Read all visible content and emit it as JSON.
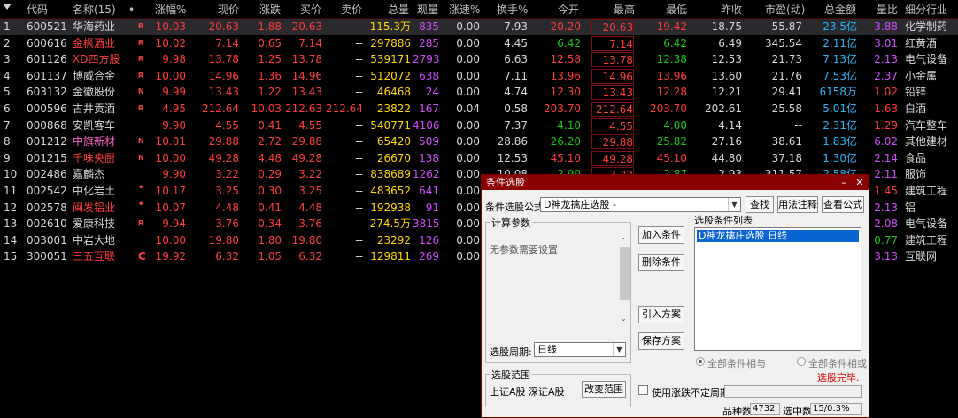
{
  "columns": [
    "代码",
    "名称(15)",
    "•",
    "涨幅%",
    "现价",
    "涨跌",
    "买价",
    "卖价",
    "总量",
    "现量",
    "涨速%",
    "换手%",
    "今开",
    "最高",
    "最低",
    "昨收",
    "市盈(动)",
    "总金额",
    "量比",
    "细分行业"
  ],
  "rows": [
    {
      "n": "1",
      "code": "600521",
      "name": "华海药业",
      "tag": "R",
      "pct": "10.03",
      "price": "20.63",
      "chg": "1.88",
      "bid": "20.63",
      "ask": "--",
      "vol": "115.3万",
      "cur": "835",
      "spd": "0.00",
      "turn": "7.93",
      "open": "20.20",
      "high": "20.63",
      "low": "19.42",
      "prev": "18.75",
      "pe": "55.87",
      "amt": "23.5亿",
      "vr": "3.88",
      "ind": "化学制药"
    },
    {
      "n": "2",
      "code": "600616",
      "name": "金枫酒业",
      "tag": "R",
      "pct": "10.02",
      "price": "7.14",
      "chg": "0.65",
      "bid": "7.14",
      "ask": "--",
      "vol": "297886",
      "cur": "285",
      "spd": "0.00",
      "turn": "4.45",
      "open": "6.42",
      "high": "7.14",
      "low": "6.42",
      "prev": "6.49",
      "pe": "345.54",
      "amt": "2.11亿",
      "vr": "3.01",
      "ind": "红黄酒"
    },
    {
      "n": "3",
      "code": "601126",
      "name": "XD四方股",
      "tag": "R",
      "pct": "9.98",
      "price": "13.78",
      "chg": "1.25",
      "bid": "13.78",
      "ask": "--",
      "vol": "539171",
      "cur": "2793",
      "spd": "0.00",
      "turn": "6.63",
      "open": "12.58",
      "high": "13.78",
      "low": "12.38",
      "prev": "12.53",
      "pe": "21.73",
      "amt": "7.13亿",
      "vr": "2.13",
      "ind": "电气设备"
    },
    {
      "n": "4",
      "code": "601137",
      "name": "博威合金",
      "tag": "R",
      "pct": "10.00",
      "price": "14.96",
      "chg": "1.36",
      "bid": "14.96",
      "ask": "--",
      "vol": "512072",
      "cur": "638",
      "spd": "0.00",
      "turn": "7.11",
      "open": "13.96",
      "high": "14.96",
      "low": "13.96",
      "prev": "13.60",
      "pe": "21.76",
      "amt": "7.53亿",
      "vr": "2.37",
      "ind": "小金属"
    },
    {
      "n": "5",
      "code": "603132",
      "name": "金徽股份",
      "tag": "N",
      "pct": "9.99",
      "price": "13.43",
      "chg": "1.22",
      "bid": "13.43",
      "ask": "--",
      "vol": "46468",
      "cur": "24",
      "spd": "0.00",
      "turn": "4.74",
      "open": "12.30",
      "high": "13.43",
      "low": "12.28",
      "prev": "12.21",
      "pe": "29.41",
      "amt": "6158万",
      "vr": "1.02",
      "ind": "铅锌"
    },
    {
      "n": "6",
      "code": "000596",
      "name": "古井贡酒",
      "tag": "R",
      "pct": "4.95",
      "price": "212.64",
      "chg": "10.03",
      "bid": "212.63",
      "ask": "212.64",
      "vol": "23822",
      "cur": "167",
      "spd": "0.04",
      "turn": "0.58",
      "open": "203.70",
      "high": "212.64",
      "low": "203.70",
      "prev": "202.61",
      "pe": "25.58",
      "amt": "5.01亿",
      "vr": "1.63",
      "ind": "白酒"
    },
    {
      "n": "7",
      "code": "000868",
      "name": "安凯客车",
      "tag": "",
      "pct": "9.90",
      "price": "4.55",
      "chg": "0.41",
      "bid": "4.55",
      "ask": "--",
      "vol": "540771",
      "cur": "4106",
      "spd": "0.00",
      "turn": "7.37",
      "open": "4.10",
      "high": "4.55",
      "low": "4.00",
      "prev": "4.14",
      "pe": "--",
      "amt": "2.31亿",
      "vr": "1.29",
      "ind": "汽车整车"
    },
    {
      "n": "8",
      "code": "001212",
      "name": "中旗新材",
      "tag": "N",
      "pct": "10.01",
      "price": "29.88",
      "chg": "2.72",
      "bid": "29.88",
      "ask": "--",
      "vol": "65420",
      "cur": "509",
      "spd": "0.00",
      "turn": "28.86",
      "open": "26.20",
      "high": "29.88",
      "low": "25.82",
      "prev": "27.16",
      "pe": "38.61",
      "amt": "1.83亿",
      "vr": "6.02",
      "ind": "其他建材"
    },
    {
      "n": "9",
      "code": "001215",
      "name": "千味央厨",
      "tag": "N",
      "pct": "10.00",
      "price": "49.28",
      "chg": "4.48",
      "bid": "49.28",
      "ask": "--",
      "vol": "26670",
      "cur": "138",
      "spd": "0.00",
      "turn": "12.53",
      "open": "45.10",
      "high": "49.28",
      "low": "45.10",
      "prev": "44.80",
      "pe": "37.18",
      "amt": "1.30亿",
      "vr": "2.14",
      "ind": "食品"
    },
    {
      "n": "10",
      "code": "002486",
      "name": "嘉麟杰",
      "tag": "",
      "pct": "9.90",
      "price": "3.22",
      "chg": "0.29",
      "bid": "3.22",
      "ask": "--",
      "vol": "838689",
      "cur": "1262",
      "spd": "0.00",
      "turn": "10.08",
      "open": "2.90",
      "high": "3.22",
      "low": "2.87",
      "prev": "2.93",
      "pe": "311.57",
      "amt": "2.58亿",
      "vr": "2.11",
      "ind": "服饰"
    },
    {
      "n": "11",
      "code": "002542",
      "name": "中化岩土",
      "tag": "•",
      "pct": "10.17",
      "price": "3.25",
      "chg": "0.30",
      "bid": "3.25",
      "ask": "--",
      "vol": "483652",
      "cur": "641",
      "spd": "0.00",
      "turn": "",
      "open": "",
      "high": "",
      "low": "",
      "prev": "",
      "pe": "",
      "amt": "",
      "vr": "1.45",
      "ind": "建筑工程"
    },
    {
      "n": "12",
      "code": "002578",
      "name": "闽发铝业",
      "tag": "•",
      "pct": "10.07",
      "price": "4.48",
      "chg": "0.41",
      "bid": "4.48",
      "ask": "--",
      "vol": "192938",
      "cur": "91",
      "spd": "0.00",
      "turn": "",
      "open": "",
      "high": "",
      "low": "",
      "prev": "",
      "pe": "",
      "amt": "",
      "vr": "2.13",
      "ind": "铝"
    },
    {
      "n": "13",
      "code": "002610",
      "name": "爱康科技",
      "tag": "R",
      "pct": "9.94",
      "price": "3.76",
      "chg": "0.34",
      "bid": "3.76",
      "ask": "--",
      "vol": "274.5万",
      "cur": "3815",
      "spd": "0.00",
      "turn": "",
      "open": "",
      "high": "",
      "low": "",
      "prev": "",
      "pe": "",
      "amt": "",
      "vr": "2.08",
      "ind": "电气设备"
    },
    {
      "n": "14",
      "code": "003001",
      "name": "中岩大地",
      "tag": "",
      "pct": "10.00",
      "price": "19.80",
      "chg": "1.80",
      "bid": "19.80",
      "ask": "--",
      "vol": "23292",
      "cur": "126",
      "spd": "0.00",
      "turn": "",
      "open": "",
      "high": "",
      "low": "",
      "prev": "",
      "pe": "",
      "amt": "",
      "vr": "0.77",
      "ind": "建筑工程"
    },
    {
      "n": "15",
      "code": "300051",
      "name": "三五互联",
      "tag": "C",
      "pct": "19.92",
      "price": "6.32",
      "chg": "1.05",
      "bid": "6.32",
      "ask": "--",
      "vol": "129811",
      "cur": "269",
      "spd": "0.00",
      "turn": "",
      "open": "",
      "high": "",
      "low": "",
      "prev": "",
      "pe": "",
      "amt": "",
      "vr": "3.13",
      "ind": "互联网"
    }
  ],
  "dialog": {
    "title": "条件选股",
    "formula_label": "条件选股公式",
    "formula_value": "D神龙擒庄选股 -",
    "btn_find": "查找",
    "btn_usage": "用法注释",
    "btn_view": "查看公式",
    "params_group": "计算参数",
    "params_text": "无参数需要设置",
    "btn_add": "加入条件",
    "btn_delete": "删除条件",
    "btn_import": "引入方案",
    "btn_save": "保存方案",
    "list_label": "选股条件列表",
    "list_item": "D神龙擒庄选股  日线",
    "period_label": "选股周期:",
    "period_value": "日线",
    "radio_and": "全部条件相与",
    "radio_or": "全部条件相或",
    "status": "选股完毕.",
    "range_group": "选股范围",
    "range_value": "上证A股 深证A股",
    "btn_change": "改变范围",
    "chk_label": "使用涨跌不定周期",
    "count_label": "品种数",
    "count_value": "4732",
    "hit_label": "选中数",
    "hit_value": "15/0.3%"
  },
  "colors": {
    "rise": "#ff3b3b",
    "fall": "#14c814",
    "title_bar": "#8b0000",
    "selection": "#0a64d2"
  }
}
